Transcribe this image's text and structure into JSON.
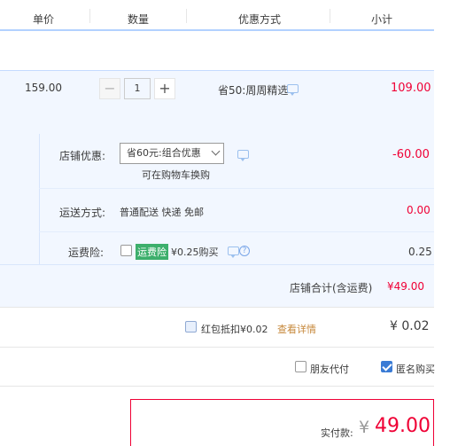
{
  "header": {
    "col_price": "单价",
    "col_qty": "数量",
    "col_promo": "优惠方式",
    "col_subtotal": "小计"
  },
  "product": {
    "unit_price": "159.00",
    "qty_minus": "−",
    "qty_value": "1",
    "qty_plus": "+",
    "promo": "省50:周周精选",
    "subtotal": "109.00"
  },
  "store": {
    "discount_label": "店铺优惠:",
    "discount_select": "省60元:组合优惠",
    "discount_note": "可在购物车换购",
    "discount_value": "-60.00",
    "shipping_label": "运送方式:",
    "shipping_text": "普通配送 快递 免邮",
    "shipping_value": "0.00",
    "insurance_label": "运费险:",
    "insurance_tag": "运费险",
    "insurance_price": "¥0.25购买",
    "insurance_value": "0.25",
    "total_label": "店铺合计(含运费)",
    "total_value": "¥49.00"
  },
  "redpacket": {
    "label": "红包抵扣¥0.02",
    "link": "查看详情",
    "value": "¥ 0.02"
  },
  "options": {
    "friend_pay": "朋友代付",
    "anonymous": "匿名购买"
  },
  "payment": {
    "label": "实付款:",
    "currency": "¥",
    "amount": "49.00"
  },
  "colors": {
    "accent_red": "#ef0035",
    "accent_blue": "#3a7bd5",
    "row_bg": "#f2f7ff",
    "tag_green": "#3daf6c"
  }
}
